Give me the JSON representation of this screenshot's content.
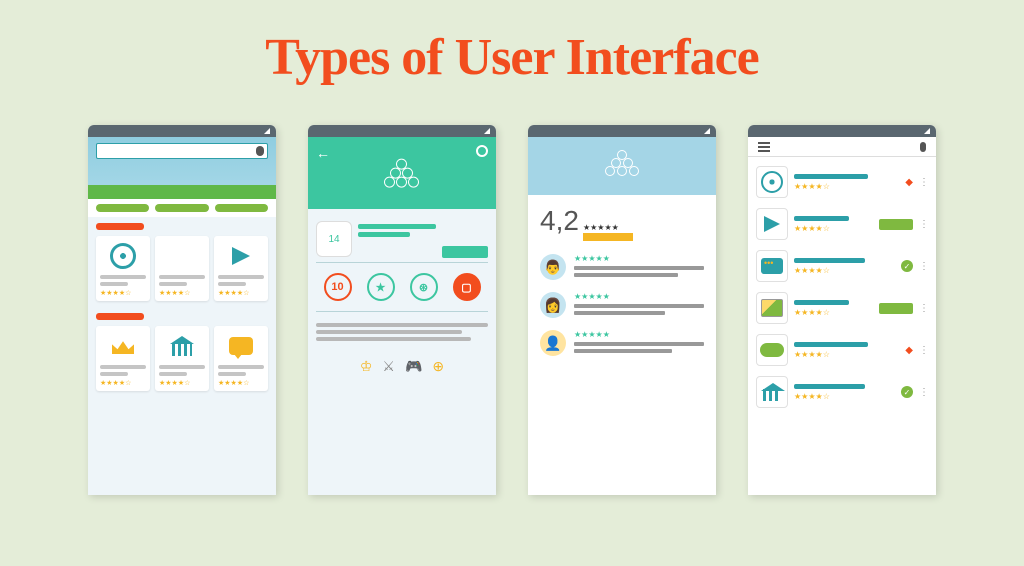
{
  "title": "Types of User Interface",
  "colors": {
    "accent": "#f24d1e",
    "teal": "#2c9fa8",
    "green": "#7fb940",
    "mint": "#3cc6a0",
    "gold": "#f5b623",
    "sky": "#a4d5e6"
  },
  "phone1": {
    "type": "store-home",
    "sections": [
      {
        "cards": [
          {
            "icon": "aperture"
          },
          {
            "icon": "blank"
          },
          {
            "icon": "plane"
          }
        ]
      },
      {
        "cards": [
          {
            "icon": "crown"
          },
          {
            "icon": "bank"
          },
          {
            "icon": "chat"
          }
        ]
      }
    ]
  },
  "phone2": {
    "type": "app-detail",
    "featured_badge": "14",
    "category_icons": [
      {
        "label": "10",
        "color": "#f24d1e"
      },
      {
        "label": "★",
        "color": "#3cc6a0"
      },
      {
        "label": "⊛",
        "color": "#3cc6a0"
      },
      {
        "label": "▢",
        "color": "#f24d1e"
      }
    ],
    "bottom_icons": [
      "crown",
      "swords",
      "gamepad",
      "basketball"
    ]
  },
  "phone3": {
    "type": "reviews",
    "rating": "4,2",
    "rating_stars": "★★★★★",
    "reviews": [
      {
        "avatar": "👨",
        "stars": "★★★★★"
      },
      {
        "avatar": "👩",
        "stars": "★★★★★"
      },
      {
        "avatar": "👤",
        "stars": "★★★★★"
      }
    ]
  },
  "phone4": {
    "type": "app-list",
    "items": [
      {
        "icon": "aperture",
        "stars": "★★★★☆",
        "badge": "diamond"
      },
      {
        "icon": "plane",
        "stars": "★★★★☆",
        "badge": "none"
      },
      {
        "icon": "chat",
        "stars": "★★★★☆",
        "badge": "check"
      },
      {
        "icon": "picture",
        "stars": "★★★★☆",
        "badge": "none"
      },
      {
        "icon": "gamepad",
        "stars": "★★★★☆",
        "badge": "diamond"
      },
      {
        "icon": "bank",
        "stars": "★★★★☆",
        "badge": "check"
      }
    ]
  }
}
